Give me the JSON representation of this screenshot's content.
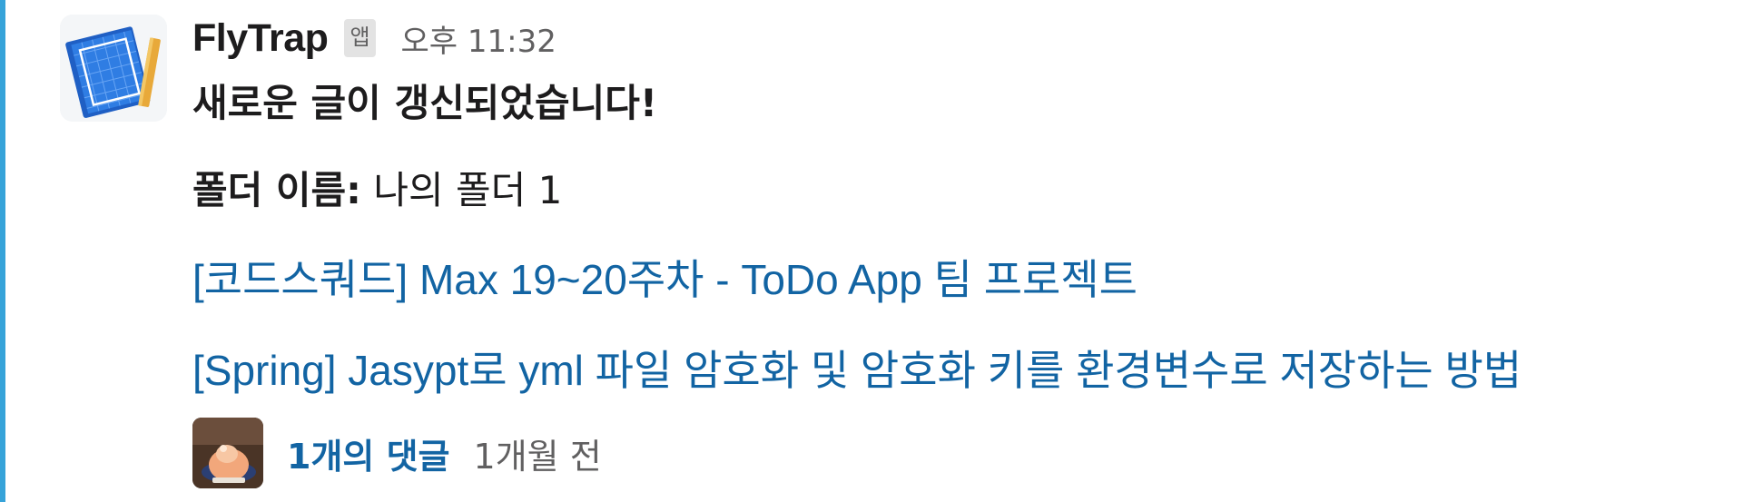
{
  "message": {
    "sender": "FlyTrap",
    "app_badge": "앱",
    "timestamp": "오후 11:32",
    "headline": "새로운 글이 갱신되었습니다!",
    "folder_label": "폴더 이름:",
    "folder_value": "나의 폴더 1",
    "links": [
      "[코드스쿼드] Max 19~20주차 - ToDo App 팀 프로젝트",
      "[Spring] Jasypt로 yml 파일 암호화 및 암호화 키를 환경변수로 저장하는 방법"
    ]
  },
  "thread": {
    "reply_count": "1개의 댓글",
    "last_reply": "1개월 전"
  },
  "colors": {
    "accent_bar": "#36a3d9",
    "link": "#1264a3",
    "muted_text": "#616061"
  },
  "icons": {
    "sender_avatar": "blueprint-notebook-icon",
    "replier_avatar": "user-photo-avatar"
  }
}
